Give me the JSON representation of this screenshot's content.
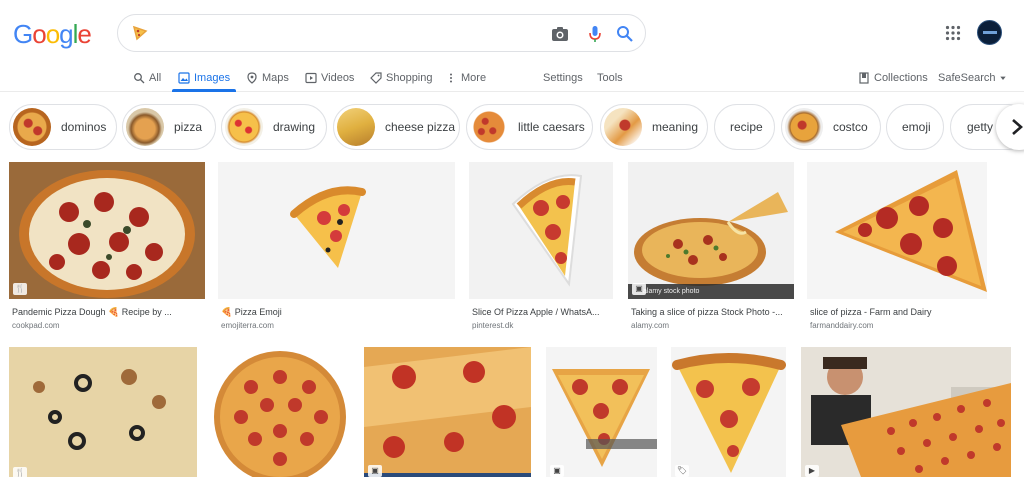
{
  "logo": {
    "letters": [
      "G",
      "o",
      "o",
      "g",
      "l",
      "e"
    ],
    "colors": [
      "#4285F4",
      "#EA4335",
      "#FBBC05",
      "#4285F4",
      "#34A853",
      "#EA4335"
    ]
  },
  "search": {
    "query_icon": "pizza-slice-icon",
    "value": ""
  },
  "tabs": [
    {
      "label": "All",
      "icon": "search-icon"
    },
    {
      "label": "Images",
      "icon": "image-icon",
      "active": true
    },
    {
      "label": "Maps",
      "icon": "map-pin-icon"
    },
    {
      "label": "Videos",
      "icon": "video-icon"
    },
    {
      "label": "Shopping",
      "icon": "tag-icon"
    },
    {
      "label": "More",
      "icon": "more-vert-icon"
    }
  ],
  "tools": {
    "settings": "Settings",
    "tools": "Tools",
    "collections": "Collections",
    "safesearch": "SafeSearch"
  },
  "chips": [
    {
      "label": "dominos"
    },
    {
      "label": "pizza"
    },
    {
      "label": "drawing"
    },
    {
      "label": "cheese pizza"
    },
    {
      "label": "little caesars"
    },
    {
      "label": "meaning"
    },
    {
      "label": "recipe"
    },
    {
      "label": "costco"
    },
    {
      "label": "emoji"
    },
    {
      "label": "getty im"
    }
  ],
  "results_row1": [
    {
      "title": "Pandemic Pizza Dough 🍕 Recipe by ...",
      "source": "cookpad.com"
    },
    {
      "title": "🍕 Pizza Emoji",
      "source": "emojiterra.com"
    },
    {
      "title": "Slice Of Pizza Apple / WhatsA...",
      "source": "pinterest.dk"
    },
    {
      "title": "Taking a slice of pizza Stock Photo -...",
      "source": "alamy.com"
    },
    {
      "title": "slice of pizza - Farm and Dairy",
      "source": "farmanddairy.com"
    }
  ],
  "alamy_watermark": "alamy stock photo",
  "colors": {
    "accent": "#1a73e8",
    "border": "#dfe1e5",
    "pepperoni": "#c0392b",
    "crust": "#e8a33c",
    "cheese": "#f6c04a"
  }
}
